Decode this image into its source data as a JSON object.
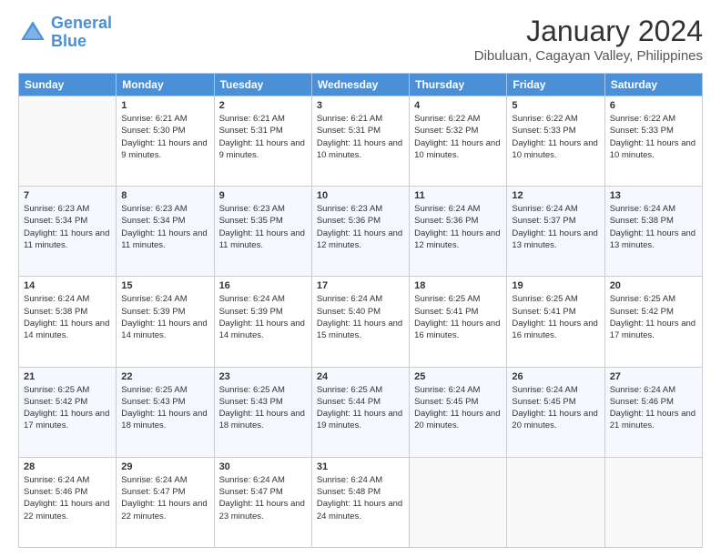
{
  "logo": {
    "line1": "General",
    "line2": "Blue"
  },
  "title": "January 2024",
  "subtitle": "Dibuluan, Cagayan Valley, Philippines",
  "weekdays": [
    "Sunday",
    "Monday",
    "Tuesday",
    "Wednesday",
    "Thursday",
    "Friday",
    "Saturday"
  ],
  "weeks": [
    [
      {
        "day": "",
        "sunrise": "",
        "sunset": "",
        "daylight": ""
      },
      {
        "day": "1",
        "sunrise": "Sunrise: 6:21 AM",
        "sunset": "Sunset: 5:30 PM",
        "daylight": "Daylight: 11 hours and 9 minutes."
      },
      {
        "day": "2",
        "sunrise": "Sunrise: 6:21 AM",
        "sunset": "Sunset: 5:31 PM",
        "daylight": "Daylight: 11 hours and 9 minutes."
      },
      {
        "day": "3",
        "sunrise": "Sunrise: 6:21 AM",
        "sunset": "Sunset: 5:31 PM",
        "daylight": "Daylight: 11 hours and 10 minutes."
      },
      {
        "day": "4",
        "sunrise": "Sunrise: 6:22 AM",
        "sunset": "Sunset: 5:32 PM",
        "daylight": "Daylight: 11 hours and 10 minutes."
      },
      {
        "day": "5",
        "sunrise": "Sunrise: 6:22 AM",
        "sunset": "Sunset: 5:33 PM",
        "daylight": "Daylight: 11 hours and 10 minutes."
      },
      {
        "day": "6",
        "sunrise": "Sunrise: 6:22 AM",
        "sunset": "Sunset: 5:33 PM",
        "daylight": "Daylight: 11 hours and 10 minutes."
      }
    ],
    [
      {
        "day": "7",
        "sunrise": "Sunrise: 6:23 AM",
        "sunset": "Sunset: 5:34 PM",
        "daylight": "Daylight: 11 hours and 11 minutes."
      },
      {
        "day": "8",
        "sunrise": "Sunrise: 6:23 AM",
        "sunset": "Sunset: 5:34 PM",
        "daylight": "Daylight: 11 hours and 11 minutes."
      },
      {
        "day": "9",
        "sunrise": "Sunrise: 6:23 AM",
        "sunset": "Sunset: 5:35 PM",
        "daylight": "Daylight: 11 hours and 11 minutes."
      },
      {
        "day": "10",
        "sunrise": "Sunrise: 6:23 AM",
        "sunset": "Sunset: 5:36 PM",
        "daylight": "Daylight: 11 hours and 12 minutes."
      },
      {
        "day": "11",
        "sunrise": "Sunrise: 6:24 AM",
        "sunset": "Sunset: 5:36 PM",
        "daylight": "Daylight: 11 hours and 12 minutes."
      },
      {
        "day": "12",
        "sunrise": "Sunrise: 6:24 AM",
        "sunset": "Sunset: 5:37 PM",
        "daylight": "Daylight: 11 hours and 13 minutes."
      },
      {
        "day": "13",
        "sunrise": "Sunrise: 6:24 AM",
        "sunset": "Sunset: 5:38 PM",
        "daylight": "Daylight: 11 hours and 13 minutes."
      }
    ],
    [
      {
        "day": "14",
        "sunrise": "Sunrise: 6:24 AM",
        "sunset": "Sunset: 5:38 PM",
        "daylight": "Daylight: 11 hours and 14 minutes."
      },
      {
        "day": "15",
        "sunrise": "Sunrise: 6:24 AM",
        "sunset": "Sunset: 5:39 PM",
        "daylight": "Daylight: 11 hours and 14 minutes."
      },
      {
        "day": "16",
        "sunrise": "Sunrise: 6:24 AM",
        "sunset": "Sunset: 5:39 PM",
        "daylight": "Daylight: 11 hours and 14 minutes."
      },
      {
        "day": "17",
        "sunrise": "Sunrise: 6:24 AM",
        "sunset": "Sunset: 5:40 PM",
        "daylight": "Daylight: 11 hours and 15 minutes."
      },
      {
        "day": "18",
        "sunrise": "Sunrise: 6:25 AM",
        "sunset": "Sunset: 5:41 PM",
        "daylight": "Daylight: 11 hours and 16 minutes."
      },
      {
        "day": "19",
        "sunrise": "Sunrise: 6:25 AM",
        "sunset": "Sunset: 5:41 PM",
        "daylight": "Daylight: 11 hours and 16 minutes."
      },
      {
        "day": "20",
        "sunrise": "Sunrise: 6:25 AM",
        "sunset": "Sunset: 5:42 PM",
        "daylight": "Daylight: 11 hours and 17 minutes."
      }
    ],
    [
      {
        "day": "21",
        "sunrise": "Sunrise: 6:25 AM",
        "sunset": "Sunset: 5:42 PM",
        "daylight": "Daylight: 11 hours and 17 minutes."
      },
      {
        "day": "22",
        "sunrise": "Sunrise: 6:25 AM",
        "sunset": "Sunset: 5:43 PM",
        "daylight": "Daylight: 11 hours and 18 minutes."
      },
      {
        "day": "23",
        "sunrise": "Sunrise: 6:25 AM",
        "sunset": "Sunset: 5:43 PM",
        "daylight": "Daylight: 11 hours and 18 minutes."
      },
      {
        "day": "24",
        "sunrise": "Sunrise: 6:25 AM",
        "sunset": "Sunset: 5:44 PM",
        "daylight": "Daylight: 11 hours and 19 minutes."
      },
      {
        "day": "25",
        "sunrise": "Sunrise: 6:24 AM",
        "sunset": "Sunset: 5:45 PM",
        "daylight": "Daylight: 11 hours and 20 minutes."
      },
      {
        "day": "26",
        "sunrise": "Sunrise: 6:24 AM",
        "sunset": "Sunset: 5:45 PM",
        "daylight": "Daylight: 11 hours and 20 minutes."
      },
      {
        "day": "27",
        "sunrise": "Sunrise: 6:24 AM",
        "sunset": "Sunset: 5:46 PM",
        "daylight": "Daylight: 11 hours and 21 minutes."
      }
    ],
    [
      {
        "day": "28",
        "sunrise": "Sunrise: 6:24 AM",
        "sunset": "Sunset: 5:46 PM",
        "daylight": "Daylight: 11 hours and 22 minutes."
      },
      {
        "day": "29",
        "sunrise": "Sunrise: 6:24 AM",
        "sunset": "Sunset: 5:47 PM",
        "daylight": "Daylight: 11 hours and 22 minutes."
      },
      {
        "day": "30",
        "sunrise": "Sunrise: 6:24 AM",
        "sunset": "Sunset: 5:47 PM",
        "daylight": "Daylight: 11 hours and 23 minutes."
      },
      {
        "day": "31",
        "sunrise": "Sunrise: 6:24 AM",
        "sunset": "Sunset: 5:48 PM",
        "daylight": "Daylight: 11 hours and 24 minutes."
      },
      {
        "day": "",
        "sunrise": "",
        "sunset": "",
        "daylight": ""
      },
      {
        "day": "",
        "sunrise": "",
        "sunset": "",
        "daylight": ""
      },
      {
        "day": "",
        "sunrise": "",
        "sunset": "",
        "daylight": ""
      }
    ]
  ]
}
